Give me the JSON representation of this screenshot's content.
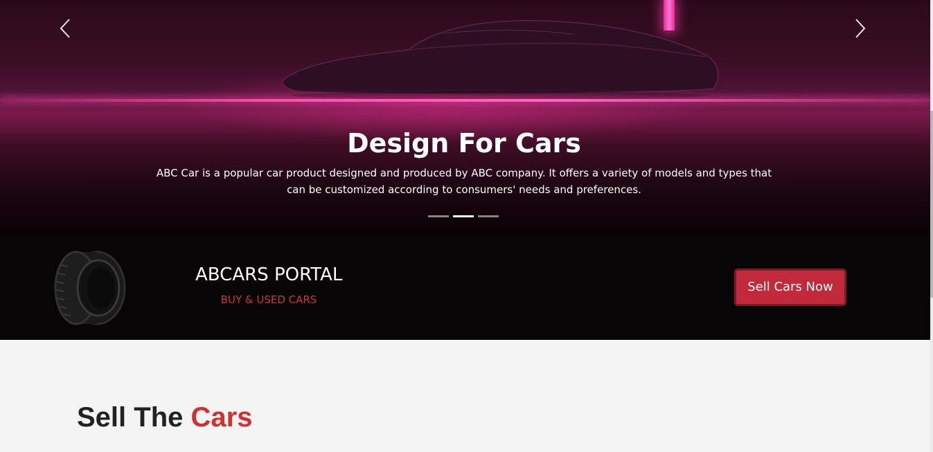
{
  "hero": {
    "title": "Design For Cars",
    "description": "ABC Car is a popular car product designed and produced by ABC company. It offers a variety of models and types that can be customized according to consumers' needs and preferences.",
    "prev_icon": "chevron-left-icon",
    "next_icon": "chevron-right-icon",
    "slide_count": 3,
    "active_slide": 2
  },
  "banner": {
    "icon": "tire-icon",
    "title": "ABCARS PORTAL",
    "subtitle": "BUY & USED CARS",
    "button_label": "Sell Cars Now"
  },
  "section": {
    "title_part1": "Sell The",
    "title_accent": "Cars"
  },
  "colors": {
    "accent": "#d32f2f",
    "button": "#c22a3b",
    "banner_bg": "#070505",
    "neon": "#ff4fb0"
  }
}
